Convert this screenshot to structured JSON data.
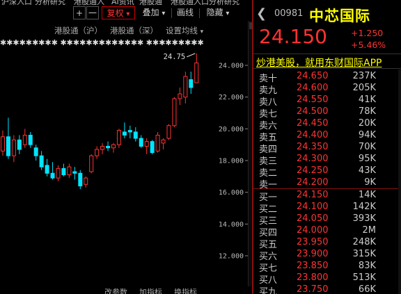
{
  "top_strip": [
    "沪深入口",
    "分析研究",
    "港股通入",
    "AI资讯",
    "港股通",
    "港股通入口",
    "分析研究",
    "港股专区"
  ],
  "toolbar": {
    "plus": "+",
    "minus": "一",
    "fq_label": "复权",
    "fq_caret": "▾",
    "overlay_label": "叠加",
    "overlay_caret": "▾",
    "drawline_label": "画线",
    "hide_label": "隐藏",
    "hide_caret": "▾"
  },
  "subbar": {
    "hk_sh": "港股通（沪）",
    "hk_sz": "港股通（深）",
    "ma_settings": "设置均线",
    "ma_caret": "▾"
  },
  "signal_dots": "✱✱✱✱✱✱✱✱✱     ✱✱✱✱✱✱✱✱✱✱✱✱✱     ✱✱✱✱✱✱✱✱✱",
  "bottom_strip": [
    "改参数",
    "加指标",
    "换指标"
  ],
  "chart_data": {
    "type": "candlestick",
    "y_ticks": [
      "24.000",
      "22.000",
      "20.000",
      "18.000",
      "16.000",
      "14.000",
      "12.000"
    ],
    "y_tick_values": [
      24,
      22,
      20,
      18,
      16,
      14,
      12
    ],
    "max_label": "24.75",
    "up_color": "#ff3333",
    "down_color": "#00e5ff",
    "candles": [
      {
        "o": 18.6,
        "h": 19.9,
        "l": 18.3,
        "c": 19.5
      },
      {
        "o": 19.5,
        "h": 20.7,
        "l": 18.1,
        "c": 18.3
      },
      {
        "o": 18.3,
        "h": 19.6,
        "l": 17.9,
        "c": 19.3
      },
      {
        "o": 19.3,
        "h": 19.6,
        "l": 18.4,
        "c": 18.7
      },
      {
        "o": 19.0,
        "h": 20.0,
        "l": 18.8,
        "c": 19.6
      },
      {
        "o": 19.6,
        "h": 19.8,
        "l": 18.8,
        "c": 19.0
      },
      {
        "o": 18.8,
        "h": 19.0,
        "l": 18.0,
        "c": 18.3
      },
      {
        "o": 18.3,
        "h": 18.6,
        "l": 17.4,
        "c": 17.6
      },
      {
        "o": 17.7,
        "h": 18.1,
        "l": 17.0,
        "c": 17.2
      },
      {
        "o": 17.2,
        "h": 17.9,
        "l": 16.8,
        "c": 16.9
      },
      {
        "o": 16.9,
        "h": 17.7,
        "l": 16.7,
        "c": 17.5
      },
      {
        "o": 17.5,
        "h": 17.8,
        "l": 17.0,
        "c": 17.1
      },
      {
        "o": 17.1,
        "h": 17.8,
        "l": 16.9,
        "c": 17.6
      },
      {
        "o": 17.3,
        "h": 17.6,
        "l": 16.8,
        "c": 17.2
      },
      {
        "o": 17.2,
        "h": 17.4,
        "l": 16.2,
        "c": 16.4
      },
      {
        "o": 16.5,
        "h": 17.0,
        "l": 16.3,
        "c": 16.9
      },
      {
        "o": 17.3,
        "h": 18.4,
        "l": 17.2,
        "c": 18.3
      },
      {
        "o": 18.3,
        "h": 18.9,
        "l": 18.1,
        "c": 18.7
      },
      {
        "o": 18.7,
        "h": 19.1,
        "l": 18.4,
        "c": 18.9
      },
      {
        "o": 18.9,
        "h": 19.2,
        "l": 18.6,
        "c": 18.8
      },
      {
        "o": 18.8,
        "h": 19.1,
        "l": 18.5,
        "c": 19.0
      },
      {
        "o": 19.0,
        "h": 20.0,
        "l": 18.8,
        "c": 19.9
      },
      {
        "o": 19.8,
        "h": 20.4,
        "l": 19.4,
        "c": 19.6
      },
      {
        "o": 19.9,
        "h": 20.2,
        "l": 19.4,
        "c": 19.8
      },
      {
        "o": 19.8,
        "h": 20.1,
        "l": 19.2,
        "c": 19.4
      },
      {
        "o": 19.4,
        "h": 19.6,
        "l": 18.8,
        "c": 18.9
      },
      {
        "o": 18.9,
        "h": 19.4,
        "l": 18.4,
        "c": 19.2
      },
      {
        "o": 19.2,
        "h": 19.3,
        "l": 18.4,
        "c": 18.5
      },
      {
        "o": 18.6,
        "h": 19.8,
        "l": 18.5,
        "c": 19.6
      },
      {
        "o": 19.1,
        "h": 19.4,
        "l": 18.7,
        "c": 19.3
      },
      {
        "o": 19.4,
        "h": 20.3,
        "l": 19.3,
        "c": 20.2
      },
      {
        "o": 20.2,
        "h": 22.0,
        "l": 20.1,
        "c": 21.9
      },
      {
        "o": 21.9,
        "h": 22.6,
        "l": 21.5,
        "c": 22.2
      },
      {
        "o": 22.0,
        "h": 23.6,
        "l": 21.6,
        "c": 23.3
      },
      {
        "o": 23.1,
        "h": 23.6,
        "l": 22.2,
        "c": 22.6
      },
      {
        "o": 22.9,
        "h": 24.75,
        "l": 22.9,
        "c": 24.15
      }
    ]
  },
  "quote": {
    "arrow": "❮",
    "code": "00981",
    "name": "中芯国际",
    "price": "24.150",
    "change": "+1.250",
    "pct": "+5.46%",
    "ad_text": "炒港美股，就用东财国际APP"
  },
  "asks": [
    {
      "label": "卖十",
      "price": "24.650",
      "vol": "237K"
    },
    {
      "label": "卖九",
      "price": "24.600",
      "vol": "205K"
    },
    {
      "label": "卖八",
      "price": "24.550",
      "vol": "41K"
    },
    {
      "label": "卖七",
      "price": "24.500",
      "vol": "78K"
    },
    {
      "label": "卖六",
      "price": "24.450",
      "vol": "20K"
    },
    {
      "label": "卖五",
      "price": "24.400",
      "vol": "94K"
    },
    {
      "label": "卖四",
      "price": "24.350",
      "vol": "70K"
    },
    {
      "label": "卖三",
      "price": "24.300",
      "vol": "95K"
    },
    {
      "label": "卖二",
      "price": "24.250",
      "vol": "43K"
    },
    {
      "label": "卖一",
      "price": "24.200",
      "vol": "9K"
    }
  ],
  "bids": [
    {
      "label": "买一",
      "price": "24.150",
      "vol": "14K"
    },
    {
      "label": "买二",
      "price": "24.100",
      "vol": "142K"
    },
    {
      "label": "买三",
      "price": "24.050",
      "vol": "393K"
    },
    {
      "label": "买四",
      "price": "24.000",
      "vol": "2M"
    },
    {
      "label": "买五",
      "price": "23.950",
      "vol": "248K"
    },
    {
      "label": "买六",
      "price": "23.900",
      "vol": "315K"
    },
    {
      "label": "买七",
      "price": "23.850",
      "vol": "83K"
    },
    {
      "label": "买八",
      "price": "23.800",
      "vol": "513K"
    },
    {
      "label": "买九",
      "price": "23.750",
      "vol": "66K"
    }
  ]
}
